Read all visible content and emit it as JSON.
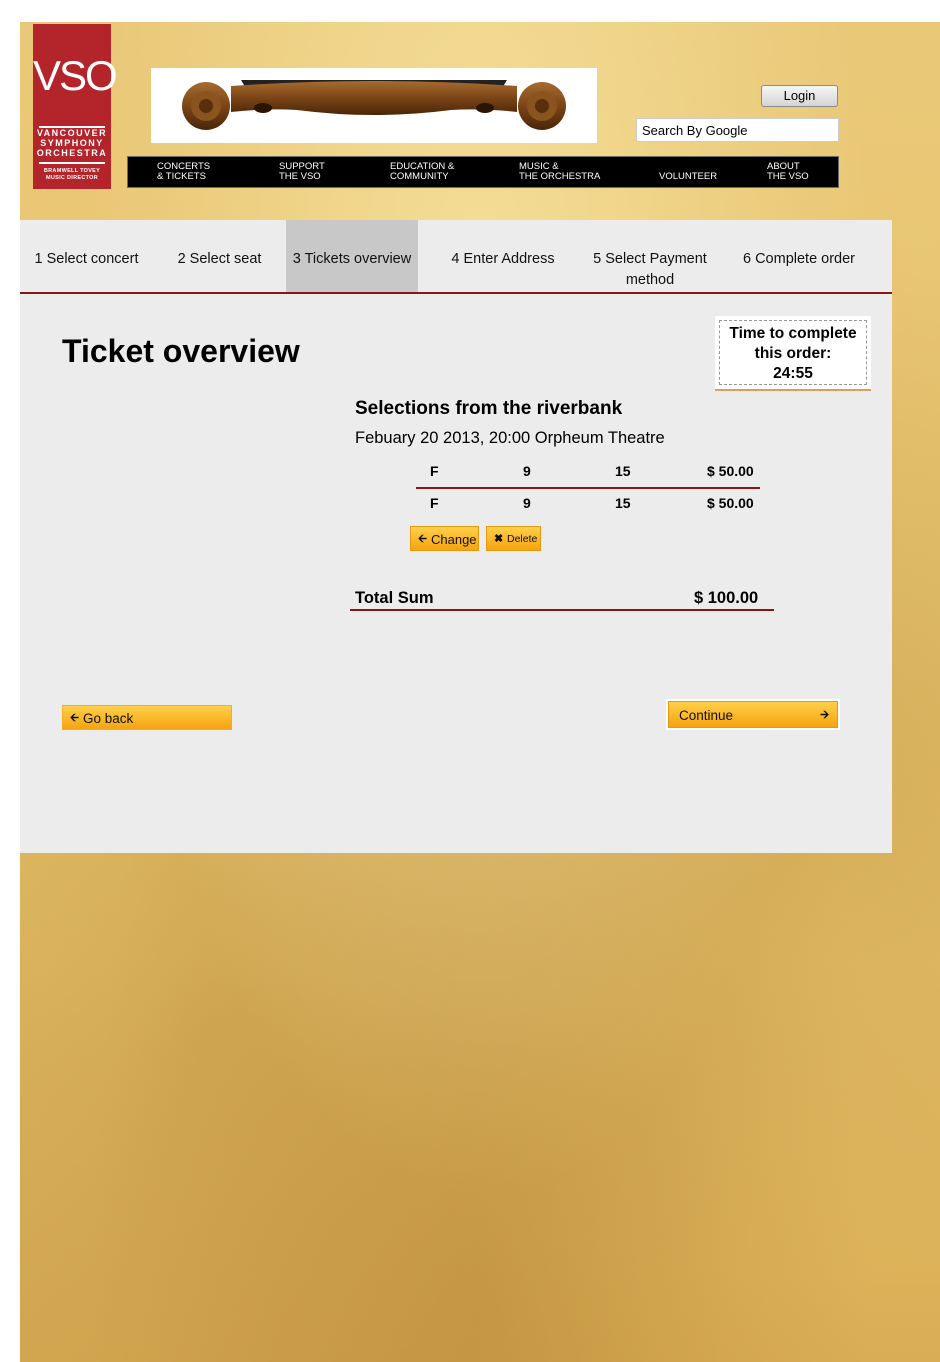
{
  "logo": {
    "letters": "VSO",
    "line1": "VANCOUVER",
    "line2": "SYMPHONY",
    "line3": "ORCHESTRA",
    "line4": "BRAMWELL TOVEY",
    "line5": "MUSIC DIRECTOR"
  },
  "header": {
    "login_label": "Login",
    "search_placeholder": "Search By Google",
    "banner_icon": "violin-scroll-image"
  },
  "nav": {
    "items": [
      {
        "label": "CONCERTS\n& TICKETS"
      },
      {
        "label": "SUPPORT\nTHE VSO"
      },
      {
        "label": "EDUCATION &\nCOMMUNITY"
      },
      {
        "label": "MUSIC &\nTHE ORCHESTRA"
      },
      {
        "label": "VOLUNTEER"
      },
      {
        "label": "ABOUT\nTHE VSO"
      }
    ]
  },
  "steps": [
    {
      "label": "1 Select concert",
      "active": false
    },
    {
      "label": "2 Select seat",
      "active": false
    },
    {
      "label": "3 Tickets overview",
      "active": true
    },
    {
      "label": "4 Enter Address",
      "active": false
    },
    {
      "label": "5 Select Payment\nmethod",
      "active": false
    },
    {
      "label": "6 Complete order",
      "active": false
    }
  ],
  "main": {
    "title": "Ticket overview",
    "timer_text": "Time to complete\nthis order:\n24:55",
    "concert_title": "Selections from the riverbank",
    "concert_subtitle": "Febuary 20 2013, 20:00 Orpheum Theatre",
    "tickets": [
      {
        "row": "F",
        "seat": "9",
        "section": "15",
        "price": "$ 50.00"
      },
      {
        "row": "F",
        "seat": "9",
        "section": "15",
        "price": "$ 50.00"
      }
    ],
    "change_label": "Change",
    "delete_label": "Delete",
    "total_label": "Total Sum",
    "total_value": "$ 100.00",
    "go_back_label": "Go back",
    "continue_label": "Continue"
  },
  "colors": {
    "accent_red": "#8b1515",
    "logo_red": "#b3242b",
    "button_yellow": "#f5a30f",
    "panel_gray": "#ececec"
  }
}
